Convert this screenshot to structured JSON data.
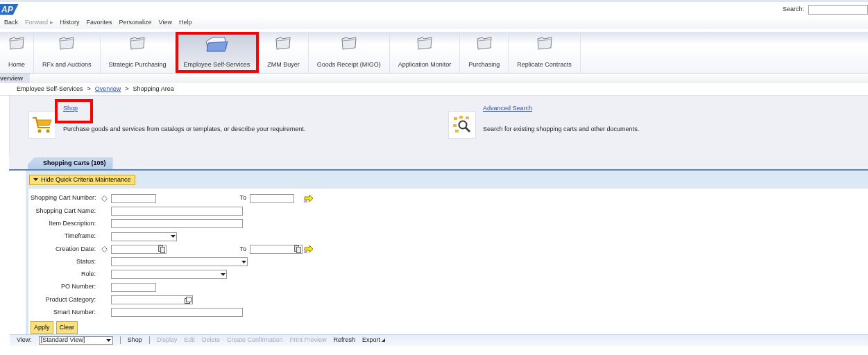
{
  "header": {
    "logo": "AP",
    "search_label": "Search:"
  },
  "menu": [
    {
      "label": "Back",
      "disabled": false
    },
    {
      "label": "Forward ▸",
      "disabled": true
    },
    {
      "label": "History",
      "disabled": false
    },
    {
      "label": "Favorites",
      "disabled": false
    },
    {
      "label": "Personalize",
      "disabled": false
    },
    {
      "label": "View",
      "disabled": false
    },
    {
      "label": "Help",
      "disabled": false
    }
  ],
  "nav_tabs": [
    {
      "label": "Home",
      "selected": false,
      "highlighted": false
    },
    {
      "label": "RFx and Auctions",
      "selected": false,
      "highlighted": false
    },
    {
      "label": "Strategic Purchasing",
      "selected": false,
      "highlighted": false
    },
    {
      "label": "Employee Self-Services",
      "selected": true,
      "highlighted": true
    },
    {
      "label": "ZMM Buyer",
      "selected": false,
      "highlighted": false
    },
    {
      "label": "Goods Receipt (MIGO)",
      "selected": false,
      "highlighted": false
    },
    {
      "label": "Application Monitor",
      "selected": false,
      "highlighted": false
    },
    {
      "label": "Purchasing",
      "selected": false,
      "highlighted": false
    },
    {
      "label": "Replicate Contracts",
      "selected": false,
      "highlighted": false
    }
  ],
  "page_tab": "verview",
  "breadcrumb": [
    {
      "label": "Employee Self-Services",
      "link": false,
      "separator": ">"
    },
    {
      "label": "Overview",
      "link": true,
      "separator": ">"
    },
    {
      "label": "Shopping Area",
      "link": false
    }
  ],
  "actions": [
    {
      "kind": "cart",
      "title": "Shop",
      "description": "Purchase goods and services from catalogs or templates, or describe your requirement.",
      "highlighted": true
    },
    {
      "kind": "search",
      "title": "Advanced Search",
      "description": "Search for existing shopping carts and other documents.",
      "highlighted": false
    }
  ],
  "result_tab": {
    "label": "Shopping Carts (105)",
    "selected": true
  },
  "criteria_toggle": "Hide Quick Criteria Maintenance",
  "fields": [
    {
      "label": "Shopping Cart Number:",
      "kind": "input-short",
      "marker": true,
      "to_label": "To"
    },
    {
      "label": "Shopping Cart Name:",
      "kind": "input-long",
      "marker": false
    },
    {
      "label": "Item Description:",
      "kind": "input-long",
      "marker": false
    },
    {
      "label": "Timeframe:",
      "kind": "select-short",
      "marker": false
    },
    {
      "label": "Creation Date:",
      "kind": "date",
      "marker": true,
      "to_label": "To"
    },
    {
      "label": "Status:",
      "kind": "select-long",
      "marker": false
    },
    {
      "label": "Role:",
      "kind": "select-medium",
      "marker": false
    },
    {
      "label": "PO Number:",
      "kind": "input-short",
      "marker": false
    },
    {
      "label": "Product Category:",
      "kind": "value-help",
      "marker": false
    },
    {
      "label": "Smart Number:",
      "kind": "input-long",
      "marker": false
    }
  ],
  "form_buttons": [
    "Apply",
    "Clear"
  ],
  "toolbar": {
    "view_label": "View:",
    "view_value": "[Standard View]",
    "items": [
      {
        "label": "Shop",
        "disabled": false,
        "menu": false
      },
      {
        "label": "Display",
        "disabled": true,
        "menu": false
      },
      {
        "label": "Edit",
        "disabled": true,
        "menu": false
      },
      {
        "label": "Delete",
        "disabled": true,
        "menu": false
      },
      {
        "label": "Create Confirmation",
        "disabled": true,
        "menu": false
      },
      {
        "label": "Print Preview",
        "disabled": true,
        "menu": false
      },
      {
        "label": "Refresh",
        "disabled": false,
        "menu": false
      },
      {
        "label": "Export",
        "disabled": false,
        "menu": true
      }
    ]
  }
}
